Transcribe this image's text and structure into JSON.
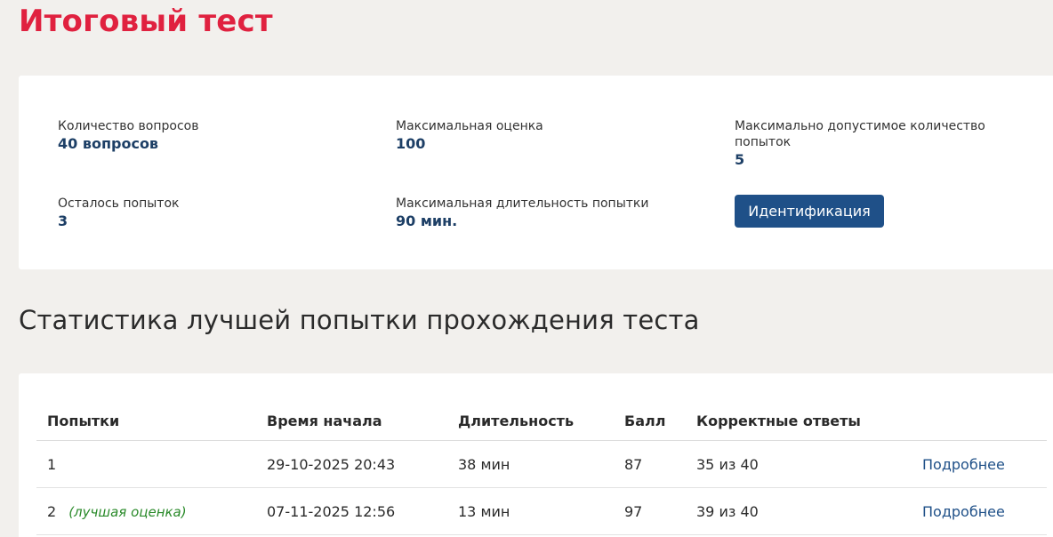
{
  "page": {
    "title": "Итоговый тест"
  },
  "info": {
    "questions_count": {
      "label": "Количество вопросов",
      "value": "40 вопросов"
    },
    "max_score": {
      "label": "Максимальная оценка",
      "value": "100"
    },
    "max_attempts": {
      "label": "Максимально допустимое количество попыток",
      "value": "5"
    },
    "attempts_left": {
      "label": "Осталось попыток",
      "value": "3"
    },
    "max_duration": {
      "label": "Максимальная длительность попытки",
      "value": "90 мин."
    },
    "ident_button": "Идентификация"
  },
  "stats": {
    "title": "Статистика лучшей попытки прохождения теста",
    "columns": [
      "Попытки",
      "Время начала",
      "Длительность",
      "Балл",
      "Корректные ответы"
    ],
    "rows": [
      {
        "attempt": "1",
        "best_label": "",
        "start": "29-10-2025 20:43",
        "duration": "38 мин",
        "score": "87",
        "correct": "35 из 40",
        "link": "Подробнее"
      },
      {
        "attempt": "2",
        "best_label": "(лучшая оценка)",
        "start": "07-11-2025 12:56",
        "duration": "13 мин",
        "score": "97",
        "correct": "39 из 40",
        "link": "Подробнее"
      }
    ]
  }
}
